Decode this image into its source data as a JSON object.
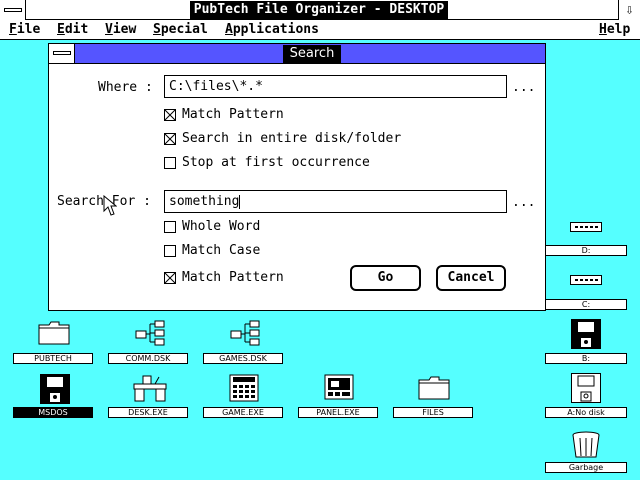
{
  "window": {
    "title": "PubTech File Organizer - DESKTOP",
    "arrow_glyph": "⇩"
  },
  "menus": [
    {
      "label": "File",
      "key": "F",
      "rest": "ile"
    },
    {
      "label": "Edit",
      "key": "E",
      "rest": "dit"
    },
    {
      "label": "View",
      "key": "V",
      "rest": "iew"
    },
    {
      "label": "Special",
      "key": "S",
      "rest": "pecial"
    },
    {
      "label": "Applications",
      "key": "A",
      "rest": "pplications"
    },
    {
      "label": "Help",
      "key": "H",
      "rest": "elp"
    }
  ],
  "dialog": {
    "title": "Search",
    "where_label": "Where :",
    "where_value": "C:\\files\\*.*",
    "browse_dots": "...",
    "options_top": [
      {
        "label": "Match Pattern",
        "checked": true
      },
      {
        "label": "Search in entire disk/folder",
        "checked": true
      },
      {
        "label": "Stop at first occurrence",
        "checked": false
      }
    ],
    "search_for_label": "Search For :",
    "search_for_value": "something",
    "options_bottom": [
      {
        "label": "Whole Word",
        "checked": false
      },
      {
        "label": "Match Case",
        "checked": false
      },
      {
        "label": "Match Pattern",
        "checked": true
      }
    ],
    "go_label": "Go",
    "cancel_label": "Cancel"
  },
  "desktop_icons": [
    {
      "id": "pubtech",
      "label": "PUBTECH",
      "kind": "folder-icon",
      "selected": false
    },
    {
      "id": "comm",
      "label": "COMM.DSK",
      "kind": "network-icon",
      "selected": false
    },
    {
      "id": "games",
      "label": "GAMES.DSK",
      "kind": "network-icon",
      "selected": false
    },
    {
      "id": "msdos",
      "label": "MSDOS",
      "kind": "floppy-icon",
      "selected": true
    },
    {
      "id": "desk",
      "label": "DESK.EXE",
      "kind": "desk-icon",
      "selected": false
    },
    {
      "id": "game",
      "label": "GAME.EXE",
      "kind": "calculator-icon",
      "selected": false
    },
    {
      "id": "panel",
      "label": "PANEL.EXE",
      "kind": "panel-icon",
      "selected": false
    },
    {
      "id": "files",
      "label": "FILES",
      "kind": "folder-icon",
      "selected": false
    }
  ],
  "drives": [
    {
      "id": "d",
      "label": "D:",
      "kind": "hard-drive-icon"
    },
    {
      "id": "c",
      "label": "C:",
      "kind": "hard-drive-icon"
    },
    {
      "id": "b",
      "label": "B:",
      "kind": "floppy-icon"
    },
    {
      "id": "a",
      "label": "A:No disk",
      "kind": "floppy-empty-icon"
    },
    {
      "id": "garbage",
      "label": "Garbage",
      "kind": "trash-icon"
    }
  ]
}
